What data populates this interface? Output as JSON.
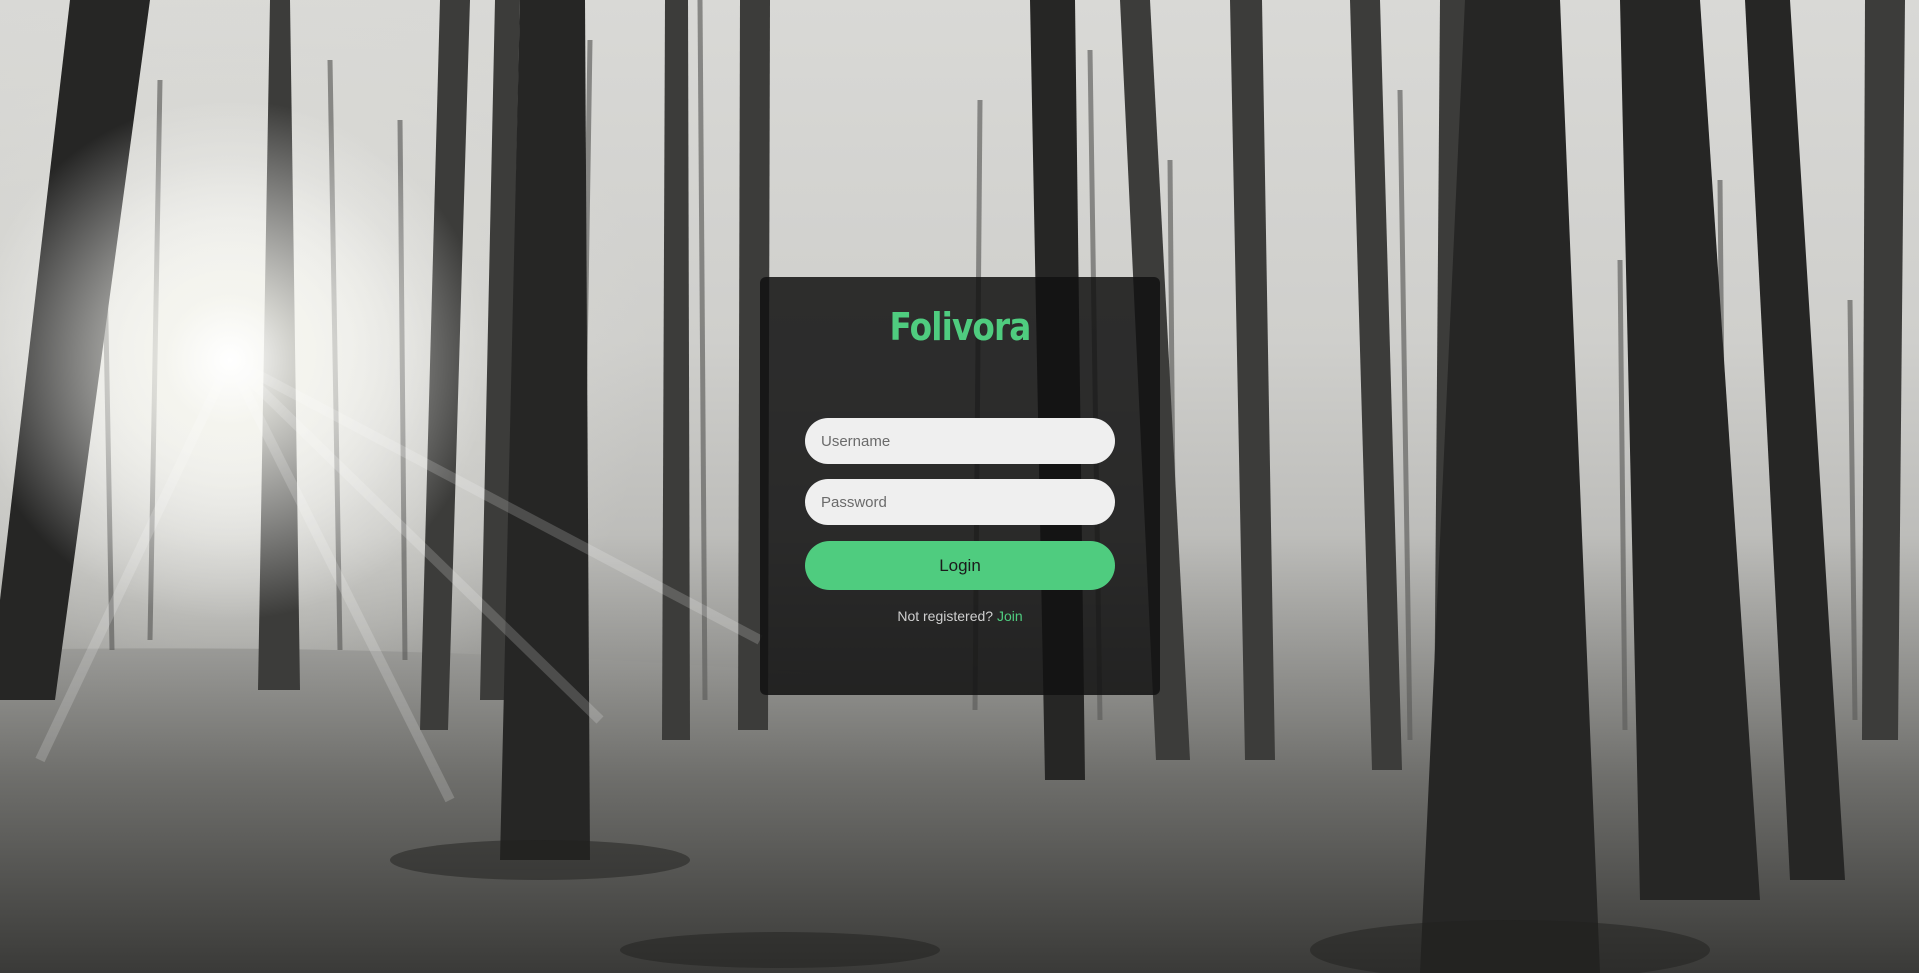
{
  "app": {
    "title": "Folivora"
  },
  "login": {
    "username_placeholder": "Username",
    "password_placeholder": "Password",
    "button_label": "Login",
    "register_prompt": "Not registered?",
    "register_link": "Join"
  },
  "colors": {
    "accent": "#4fcc7f",
    "card": "#121212",
    "field": "#efefef"
  }
}
